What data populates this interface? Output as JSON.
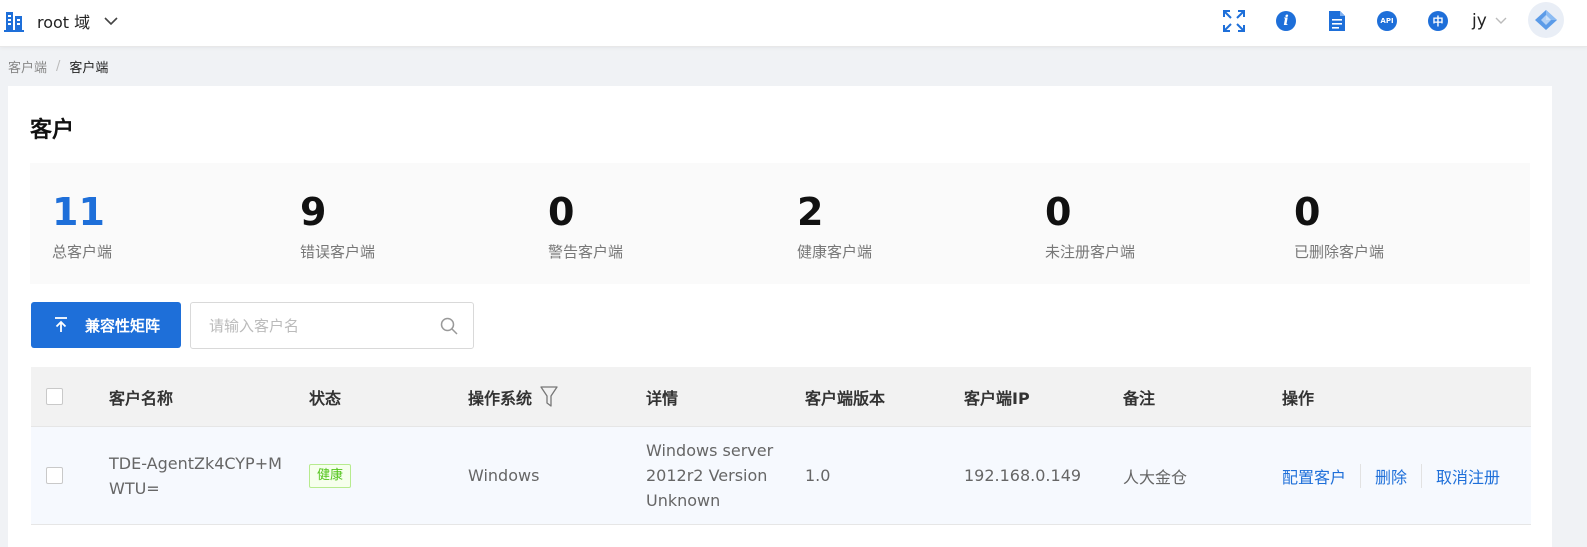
{
  "header": {
    "domain_name": "root 域",
    "icons": [
      "fullscreen-icon",
      "info-icon",
      "document-icon",
      "api-icon",
      "language-icon"
    ],
    "info_glyph": "i",
    "api_glyph": "API",
    "language_glyph": "中",
    "user_name": "jy"
  },
  "breadcrumb": {
    "home": "客户端",
    "separator": "/",
    "current": "客户端"
  },
  "page": {
    "title": "客户"
  },
  "stats": [
    {
      "value": "11",
      "label": "总客户端"
    },
    {
      "value": "9",
      "label": "错误客户端"
    },
    {
      "value": "0",
      "label": "警告客户端"
    },
    {
      "value": "2",
      "label": "健康客户端"
    },
    {
      "value": "0",
      "label": "未注册客户端"
    },
    {
      "value": "0",
      "label": "已删除客户端"
    }
  ],
  "toolbar": {
    "matrix_button": "兼容性矩阵",
    "search_placeholder": "请输入客户名"
  },
  "table": {
    "columns": {
      "name": "客户名称",
      "status": "状态",
      "os": "操作系统",
      "details": "详情",
      "version": "客户端版本",
      "ip": "客户端IP",
      "remark": "备注",
      "actions": "操作"
    },
    "rows": [
      {
        "name_line1": "TDE-AgentZk4CYP+M",
        "name_line2": "WTU=",
        "status": "健康",
        "os": "Windows",
        "details_line1": "Windows server",
        "details_line2": "2012r2 Version",
        "details_line3": "Unknown",
        "version": "1.0",
        "ip": "192.168.0.149",
        "remark": "人大金仓",
        "action_config": "配置客户",
        "action_delete": "删除",
        "action_unregister": "取消注册"
      }
    ]
  },
  "colors": {
    "primary": "#1e6fd9",
    "healthy_text": "#52c41a",
    "healthy_border": "#b7eb8f",
    "healthy_bg": "#f6ffed"
  }
}
